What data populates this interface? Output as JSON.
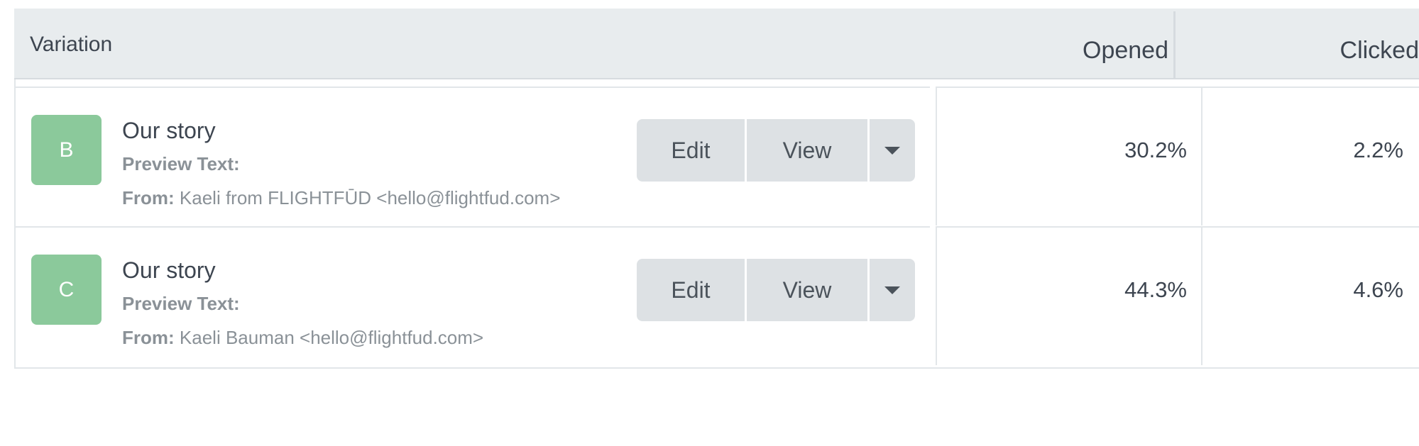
{
  "table": {
    "headers": {
      "variation": "Variation",
      "opened": "Opened",
      "clicked": "Clicked"
    },
    "rows": [
      {
        "badge": "B",
        "subject": "Our story",
        "preview_label": "Preview Text:",
        "from_label": "From:",
        "from_value": "Kaeli from FLIGHTFŪD <hello@flightfud.com>",
        "opened": "30.2%",
        "clicked": "2.2%"
      },
      {
        "badge": "C",
        "subject": "Our story",
        "preview_label": "Preview Text:",
        "from_label": "From:",
        "from_value": "Kaeli Bauman <hello@flightfud.com>",
        "opened": "44.3%",
        "clicked": "4.6%"
      }
    ],
    "actions": {
      "edit_label": "Edit",
      "view_label": "View",
      "more_icon": "caret-down-icon"
    }
  },
  "colors": {
    "badge_bg": "#8bc99b",
    "header_bg": "#e8ecee",
    "button_bg": "#dde1e4"
  }
}
